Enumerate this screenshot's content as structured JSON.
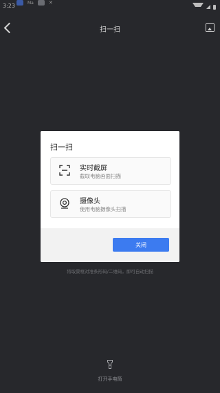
{
  "status_bar": {
    "time": "3:23",
    "apps": [
      "Ma",
      "",
      "✕"
    ]
  },
  "header": {
    "title": "扫一扫"
  },
  "dialog": {
    "title": "扫一扫",
    "options": [
      {
        "title": "实时截屏",
        "description": "截取电脑画面扫描",
        "icon": "screen-capture-icon"
      },
      {
        "title": "摄像头",
        "description": "使用电脑摄像头扫描",
        "icon": "webcam-icon"
      }
    ],
    "close_label": "关闭"
  },
  "hint": "将取景框对准条形码/二维码，即可自动扫描",
  "flashlight": {
    "label": "打开手电筒",
    "icon": "flashlight-icon"
  },
  "colors": {
    "background": "#27282c",
    "accent": "#3c7bf0"
  }
}
